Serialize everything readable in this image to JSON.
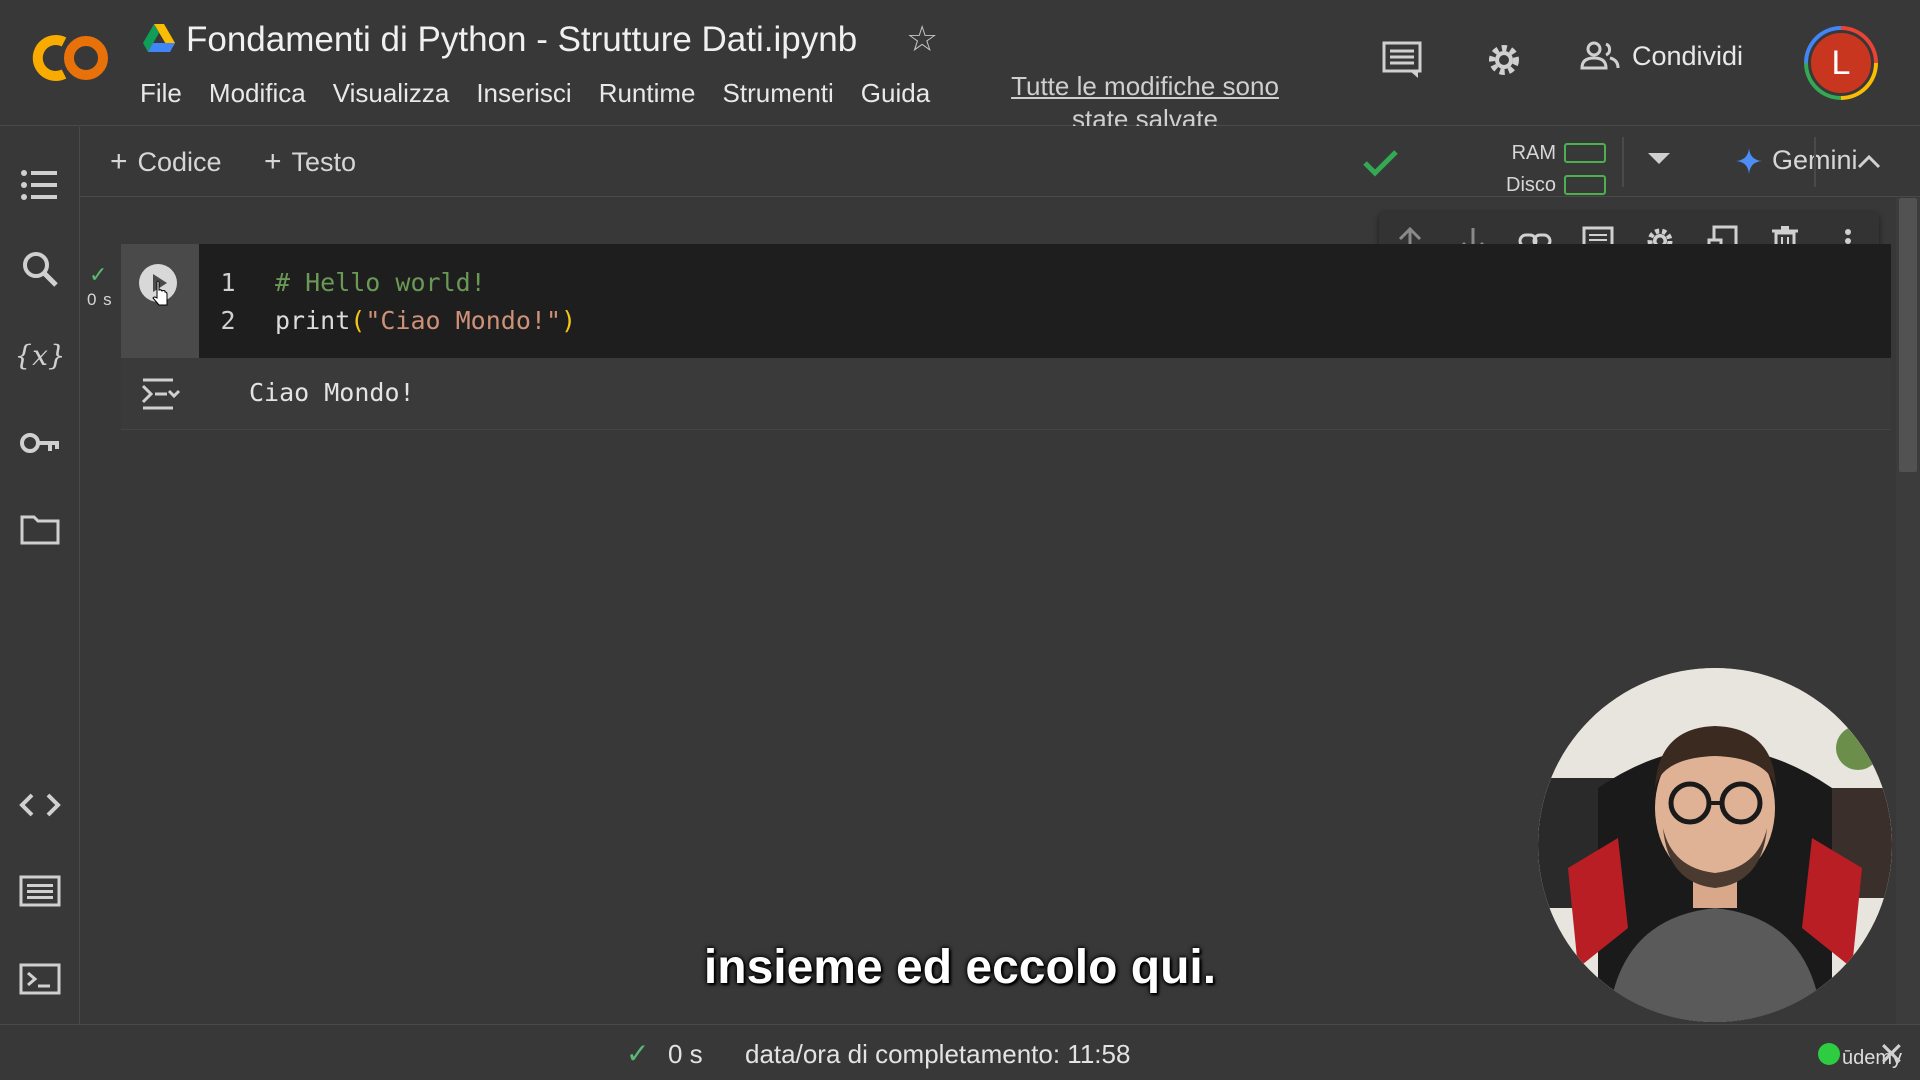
{
  "header": {
    "title": "Fondamenti di Python - Strutture Dati.ipynb",
    "menu": [
      "File",
      "Modifica",
      "Visualizza",
      "Inserisci",
      "Runtime",
      "Strumenti",
      "Guida"
    ],
    "saved_status": "Tutte le modifiche sono state salvate",
    "share_label": "Condividi",
    "avatar_initial": "L"
  },
  "toolbar": {
    "add_code": "Codice",
    "add_text": "Testo",
    "ram_label": "RAM",
    "disk_label": "Disco",
    "gemini_label": "Gemini"
  },
  "cell": {
    "exec_time": "0 s",
    "lines": [
      {
        "num": "1",
        "comment": "# Hello world!"
      },
      {
        "num": "2",
        "fn": "print",
        "open": "(",
        "str": "\"Ciao Mondo!\"",
        "close": ")"
      }
    ],
    "output": "Ciao Mondo!"
  },
  "statusbar": {
    "time": "0 s",
    "completion": "data/ora di completamento: 11:58",
    "watermark": "ūdemy"
  },
  "subtitle": "insieme ed eccolo qui.",
  "colors": {
    "accent_green": "#5bb974",
    "logo_orange": "#f9ab00",
    "avatar_red": "#c8361f"
  }
}
